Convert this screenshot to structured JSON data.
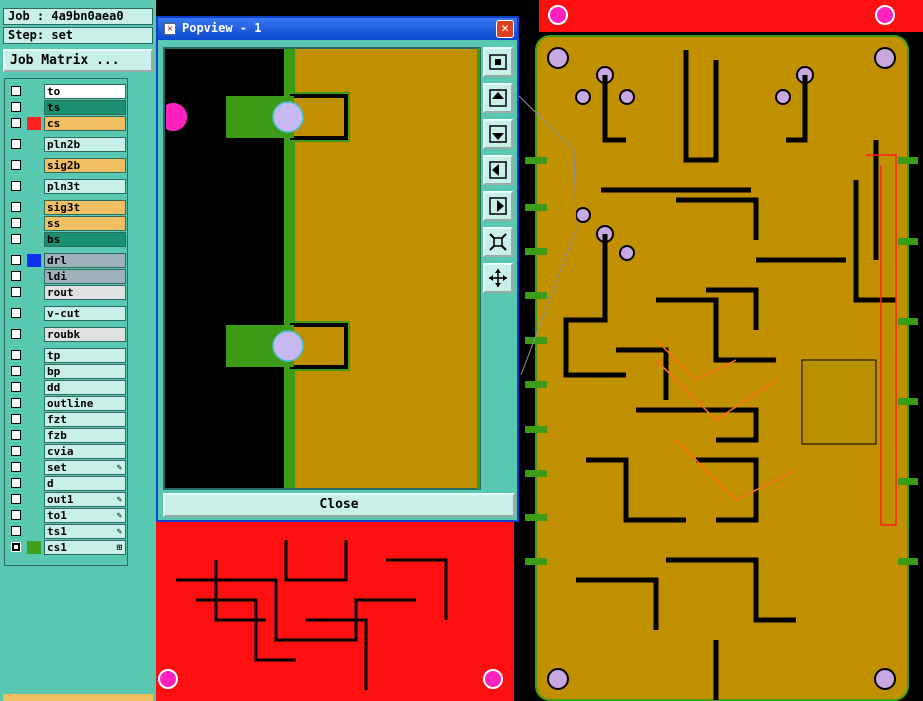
{
  "job": {
    "label": "Job : 4a9bn0aea0",
    "step": "Step: set"
  },
  "job_matrix_button": "Job Matrix ...",
  "layers": [
    {
      "name": "to",
      "color": "#ffffff",
      "swatch": ""
    },
    {
      "name": "ts",
      "color": "#1a9070",
      "swatch": ""
    },
    {
      "name": "cs",
      "color": "#f0c060",
      "swatch": "#ff2020"
    },
    {
      "name": "pln2b",
      "color": "#c8f0e8",
      "swatch": ""
    },
    {
      "name": "sig2b",
      "color": "#f0c060",
      "swatch": ""
    },
    {
      "name": "pln3t",
      "color": "#c8f0e8",
      "swatch": ""
    },
    {
      "name": "sig3t",
      "color": "#f0c060",
      "swatch": ""
    },
    {
      "name": "ss",
      "color": "#f0c060",
      "swatch": ""
    },
    {
      "name": "bs",
      "color": "#1a9070",
      "swatch": ""
    },
    {
      "name": "drl",
      "color": "#a0b0b8",
      "swatch": "#1030f0"
    },
    {
      "name": "ldi",
      "color": "#a0b0b8",
      "swatch": ""
    },
    {
      "name": "rout",
      "color": "#e0e0e0",
      "swatch": ""
    },
    {
      "name": "v-cut",
      "color": "#c8f0e8",
      "swatch": ""
    },
    {
      "name": "roubk",
      "color": "#e0e0e0",
      "swatch": ""
    },
    {
      "name": "tp",
      "color": "#c8f0e8",
      "swatch": ""
    },
    {
      "name": "bp",
      "color": "#c8f0e8",
      "swatch": ""
    },
    {
      "name": "dd",
      "color": "#c8f0e8",
      "swatch": ""
    },
    {
      "name": "outline",
      "color": "#c8f0e8",
      "swatch": ""
    },
    {
      "name": "fzt",
      "color": "#c8f0e8",
      "swatch": ""
    },
    {
      "name": "fzb",
      "color": "#c8f0e8",
      "swatch": ""
    },
    {
      "name": "cvia",
      "color": "#c8f0e8",
      "swatch": ""
    },
    {
      "name": "set",
      "color": "#c8f0e8",
      "swatch": "",
      "mark": "✎"
    },
    {
      "name": "d",
      "color": "#c8f0e8",
      "swatch": ""
    },
    {
      "name": "out1",
      "color": "#c8f0e8",
      "swatch": "",
      "mark": "✎"
    },
    {
      "name": "to1",
      "color": "#c8f0e8",
      "swatch": "",
      "mark": "✎"
    },
    {
      "name": "ts1",
      "color": "#c8f0e8",
      "swatch": "",
      "mark": "✎"
    },
    {
      "name": "cs1",
      "color": "#c8f0e8",
      "swatch": "#40a020",
      "mark": "⊞",
      "active": true
    }
  ],
  "popview": {
    "title": "Popview - 1",
    "close_label": "Close"
  },
  "colors": {
    "copper": "#c09000",
    "red_layer": "#ff1010",
    "trace": "#000000",
    "pad": "#c8b8f0",
    "green": "#3c9c18"
  }
}
